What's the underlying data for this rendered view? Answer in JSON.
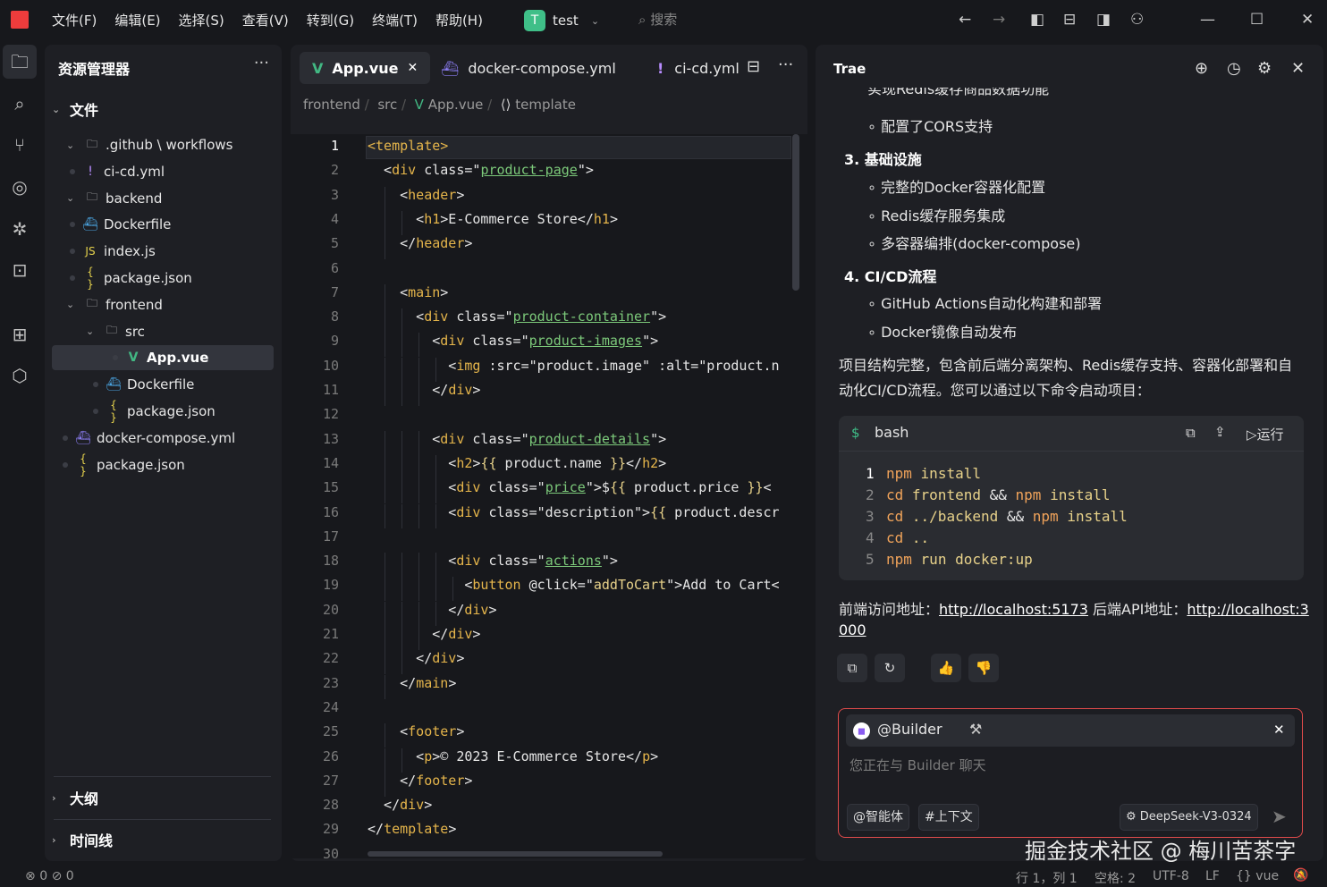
{
  "menubar": {
    "items": [
      "文件(F)",
      "编辑(E)",
      "选择(S)",
      "查看(V)",
      "转到(G)",
      "终端(T)",
      "帮助(H)"
    ],
    "project_initial": "T",
    "project_name": "test",
    "search_placeholder": "搜索"
  },
  "sidebar": {
    "title": "资源管理器",
    "section_files": "文件",
    "tree": [
      {
        "label": ".github \\ workflows",
        "icon": "folder-icon",
        "kind": "folder"
      },
      {
        "label": "ci-cd.yml",
        "icon": "yaml-icon",
        "kind": "file"
      },
      {
        "label": "backend",
        "icon": "folder-icon",
        "kind": "folder"
      },
      {
        "label": "Dockerfile",
        "icon": "docker-icon",
        "kind": "file"
      },
      {
        "label": "index.js",
        "icon": "js-icon",
        "kind": "file"
      },
      {
        "label": "package.json",
        "icon": "json-icon",
        "kind": "file"
      },
      {
        "label": "frontend",
        "icon": "folder-icon",
        "kind": "folder"
      },
      {
        "label": "src",
        "icon": "folder-icon",
        "kind": "folder"
      },
      {
        "label": "App.vue",
        "icon": "vue-icon",
        "kind": "file"
      },
      {
        "label": "Dockerfile",
        "icon": "docker-icon",
        "kind": "file"
      },
      {
        "label": "package.json",
        "icon": "json-icon",
        "kind": "file"
      },
      {
        "label": "docker-compose.yml",
        "icon": "docker-compose-icon",
        "kind": "file"
      },
      {
        "label": "package.json",
        "icon": "json-icon",
        "kind": "file"
      }
    ],
    "outline": "大纲",
    "timeline": "时间线"
  },
  "editor": {
    "tabs": [
      "App.vue",
      "docker-compose.yml",
      "ci-cd.yml"
    ],
    "breadcrumb": [
      "frontend",
      "src",
      "App.vue",
      "template"
    ],
    "lines": [
      [
        [
          "tg",
          "<template>"
        ]
      ],
      [
        [
          "w",
          "  <"
        ],
        [
          "tg",
          "div"
        ],
        [
          "w",
          " class="
        ],
        [
          "w",
          "\""
        ],
        [
          "st",
          "product-page"
        ],
        [
          "w",
          "\">"
        ]
      ],
      [
        [
          "w",
          "    <"
        ],
        [
          "tg",
          "header"
        ],
        [
          "w",
          ">"
        ]
      ],
      [
        [
          "w",
          "      <"
        ],
        [
          "tg",
          "h1"
        ],
        [
          "w",
          ">E-Commerce Store</"
        ],
        [
          "tg",
          "h1"
        ],
        [
          "w",
          ">"
        ]
      ],
      [
        [
          "w",
          "    </"
        ],
        [
          "tg",
          "header"
        ],
        [
          "w",
          ">"
        ]
      ],
      [],
      [
        [
          "w",
          "    <"
        ],
        [
          "tg",
          "main"
        ],
        [
          "w",
          ">"
        ]
      ],
      [
        [
          "w",
          "      <"
        ],
        [
          "tg",
          "div"
        ],
        [
          "w",
          " class="
        ],
        [
          "w",
          "\""
        ],
        [
          "st",
          "product-container"
        ],
        [
          "w",
          "\">"
        ]
      ],
      [
        [
          "w",
          "        <"
        ],
        [
          "tg",
          "div"
        ],
        [
          "w",
          " class="
        ],
        [
          "w",
          "\""
        ],
        [
          "st",
          "product-images"
        ],
        [
          "w",
          "\">"
        ]
      ],
      [
        [
          "w",
          "          <"
        ],
        [
          "tg",
          "img"
        ],
        [
          "w",
          " :src=\"product.image\" :alt=\"product.n"
        ]
      ],
      [
        [
          "w",
          "        </"
        ],
        [
          "tg",
          "div"
        ],
        [
          "w",
          ">"
        ]
      ],
      [],
      [
        [
          "w",
          "        <"
        ],
        [
          "tg",
          "div"
        ],
        [
          "w",
          " class="
        ],
        [
          "w",
          "\""
        ],
        [
          "st",
          "product-details"
        ],
        [
          "w",
          "\">"
        ]
      ],
      [
        [
          "w",
          "          <"
        ],
        [
          "tg",
          "h2"
        ],
        [
          "w",
          ">"
        ],
        [
          "s2",
          "{{"
        ],
        [
          "w",
          " product.name "
        ],
        [
          "s2",
          "}}"
        ],
        [
          "w",
          "</"
        ],
        [
          "tg",
          "h2"
        ],
        [
          "w",
          ">"
        ]
      ],
      [
        [
          "w",
          "          <"
        ],
        [
          "tg",
          "div"
        ],
        [
          "w",
          " class="
        ],
        [
          "w",
          "\""
        ],
        [
          "st",
          "price"
        ],
        [
          "w",
          "\">$"
        ],
        [
          "s2",
          "{{"
        ],
        [
          "w",
          " product.price "
        ],
        [
          "s2",
          "}}"
        ],
        [
          "w",
          "<"
        ]
      ],
      [
        [
          "w",
          "          <"
        ],
        [
          "tg",
          "div"
        ],
        [
          "w",
          " class=\"description\">"
        ],
        [
          "s2",
          "{{"
        ],
        [
          "w",
          " product.descr"
        ]
      ],
      [],
      [
        [
          "w",
          "          <"
        ],
        [
          "tg",
          "div"
        ],
        [
          "w",
          " class="
        ],
        [
          "w",
          "\""
        ],
        [
          "st",
          "actions"
        ],
        [
          "w",
          "\">"
        ]
      ],
      [
        [
          "w",
          "            <"
        ],
        [
          "tg",
          "button"
        ],
        [
          "w",
          " @click=\""
        ],
        [
          "s2",
          "addToCart"
        ],
        [
          "w",
          "\">Add to Cart<"
        ]
      ],
      [
        [
          "w",
          "          </"
        ],
        [
          "tg",
          "div"
        ],
        [
          "w",
          ">"
        ]
      ],
      [
        [
          "w",
          "        </"
        ],
        [
          "tg",
          "div"
        ],
        [
          "w",
          ">"
        ]
      ],
      [
        [
          "w",
          "      </"
        ],
        [
          "tg",
          "div"
        ],
        [
          "w",
          ">"
        ]
      ],
      [
        [
          "w",
          "    </"
        ],
        [
          "tg",
          "main"
        ],
        [
          "w",
          ">"
        ]
      ],
      [],
      [
        [
          "w",
          "    <"
        ],
        [
          "tg",
          "footer"
        ],
        [
          "w",
          ">"
        ]
      ],
      [
        [
          "w",
          "      <"
        ],
        [
          "tg",
          "p"
        ],
        [
          "w",
          ">© 2023 E-Commerce Store</"
        ],
        [
          "tg",
          "p"
        ],
        [
          "w",
          ">"
        ]
      ],
      [
        [
          "w",
          "    </"
        ],
        [
          "tg",
          "footer"
        ],
        [
          "w",
          ">"
        ]
      ],
      [
        [
          "w",
          "  </"
        ],
        [
          "tg",
          "div"
        ],
        [
          "w",
          ">"
        ]
      ],
      [
        [
          "w",
          "</"
        ],
        [
          "tg",
          "template"
        ],
        [
          "w",
          ">"
        ]
      ],
      []
    ]
  },
  "chat": {
    "title": "Trae",
    "partial_top": "实现Redis缓存商品数据功能",
    "items": [
      {
        "type": "bullet",
        "text": "配置了CORS支持"
      },
      {
        "type": "head",
        "text": "3. 基础设施"
      },
      {
        "type": "bullet",
        "text": "完整的Docker容器化配置"
      },
      {
        "type": "bullet",
        "text": "Redis缓存服务集成"
      },
      {
        "type": "bullet",
        "text": "多容器编排(docker-compose)"
      },
      {
        "type": "head",
        "text": "4. CI/CD流程"
      },
      {
        "type": "bullet",
        "text": "GitHub Actions自动化构建和部署"
      },
      {
        "type": "bullet",
        "text": "Docker镜像自动发布"
      }
    ],
    "summary_line1": "项目结构完整，包含前后端分离架构、Redis缓存支持、容器化部署和自",
    "summary_line2": "动化CI/CD流程。您可以通过以下命令启动项目：",
    "code_lang": "bash",
    "run_label": "运行",
    "code_lines": [
      [
        "npm",
        " install"
      ],
      [
        "cd",
        " frontend && ",
        "npm",
        " install"
      ],
      [
        "cd",
        " ../backend && ",
        "npm",
        " install"
      ],
      [
        "cd",
        " .."
      ],
      [
        "npm",
        " run docker:up"
      ]
    ],
    "access_prefix": "前端访问地址：",
    "frontend_url": "http://localhost:5173",
    "backend_prefix": " 后端API地址：",
    "backend_url_1": "http://localhost:3",
    "backend_url_2": "000",
    "builder_label": "@Builder",
    "input_placeholder": "您正在与 Builder 聊天",
    "chip_agent": "@智能体",
    "chip_context": "#上下文",
    "model": "DeepSeek-V3-0324"
  },
  "status": {
    "errors": "0",
    "warnings": "0",
    "position": "行 1，列 1",
    "indent": "空格: 2",
    "encoding": "UTF-8",
    "eol": "LF",
    "language": "vue"
  },
  "watermark": "掘金技术社区 @ 梅川苦茶字"
}
